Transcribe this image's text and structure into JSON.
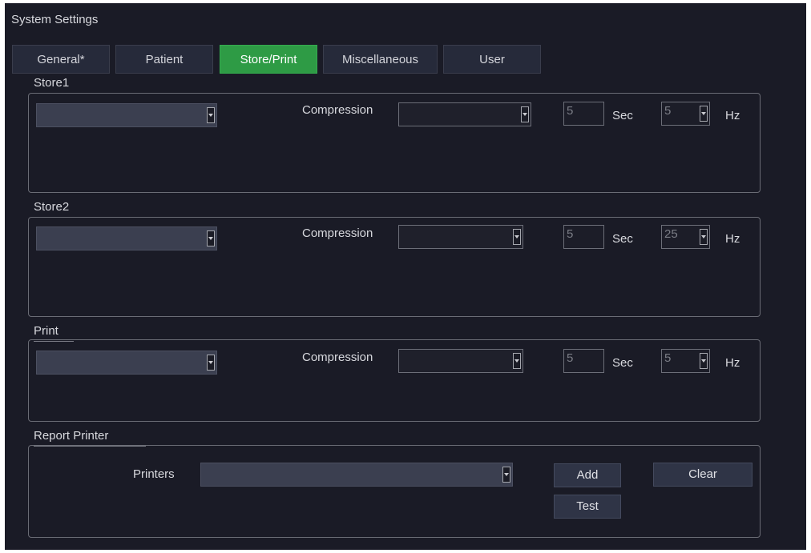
{
  "window": {
    "title": "System Settings"
  },
  "tabs": [
    {
      "label": "General*"
    },
    {
      "label": "Patient"
    },
    {
      "label": "Store/Print"
    },
    {
      "label": "Miscellaneous"
    },
    {
      "label": "User"
    }
  ],
  "active_tab": "Store/Print",
  "accent_color": "#2e9b45",
  "store1": {
    "label": "Store1",
    "device_value": "",
    "compression_label": "Compression",
    "compression_value": "",
    "seconds_value": "5",
    "seconds_unit": "Sec",
    "rate_value": "5",
    "rate_unit": "Hz"
  },
  "store2": {
    "label": "Store2",
    "device_value": "",
    "compression_label": "Compression",
    "compression_value": "",
    "seconds_value": "5",
    "seconds_unit": "Sec",
    "rate_value": "25",
    "rate_unit": "Hz"
  },
  "print": {
    "label": "Print",
    "device_value": "",
    "compression_label": "Compression",
    "compression_value": "",
    "seconds_value": "5",
    "seconds_unit": "Sec",
    "rate_value": "5",
    "rate_unit": "Hz"
  },
  "report_printer": {
    "label": "Report Printer",
    "printers_label": "Printers",
    "printers_value": "",
    "add_label": "Add",
    "test_label": "Test",
    "clear_label": "Clear"
  }
}
